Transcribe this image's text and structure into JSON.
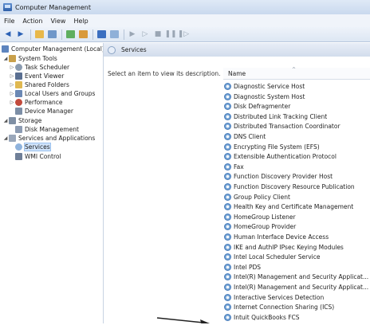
{
  "window": {
    "title": "Computer Management"
  },
  "menu": [
    "File",
    "Action",
    "View",
    "Help"
  ],
  "tree": {
    "root": "Computer Management (Local)",
    "items": [
      {
        "label": "System Tools"
      },
      {
        "label": "Task Scheduler"
      },
      {
        "label": "Event Viewer"
      },
      {
        "label": "Shared Folders"
      },
      {
        "label": "Local Users and Groups"
      },
      {
        "label": "Performance"
      },
      {
        "label": "Device Manager"
      },
      {
        "label": "Storage"
      },
      {
        "label": "Disk Management"
      },
      {
        "label": "Services and Applications"
      },
      {
        "label": "Services"
      },
      {
        "label": "WMI Control"
      }
    ]
  },
  "pane": {
    "title": "Services",
    "description": "Select an item to view its description.",
    "column_name": "Name"
  },
  "services": [
    "Diagnostic Service Host",
    "Diagnostic System Host",
    "Disk Defragmenter",
    "Distributed Link Tracking Client",
    "Distributed Transaction Coordinator",
    "DNS Client",
    "Encrypting File System (EFS)",
    "Extensible Authentication Protocol",
    "Fax",
    "Function Discovery Provider Host",
    "Function Discovery Resource Publication",
    "Group Policy Client",
    "Health Key and Certificate Management",
    "HomeGroup Listener",
    "HomeGroup Provider",
    "Human Interface Device Access",
    "IKE and AuthIP IPsec Keying Modules",
    "Intel Local Scheduler Service",
    "Intel PDS",
    "Intel(R) Management and Security Applicat...",
    "Intel(R) Management and Security Applicat...",
    "Interactive Services Detection",
    "Internet Connection Sharing (ICS)",
    "Intuit QuickBooks FCS"
  ],
  "footer_text": "                                                                                                          ",
  "colors": {
    "accent": "#2b61b5",
    "selection": "#cfe3fb"
  }
}
